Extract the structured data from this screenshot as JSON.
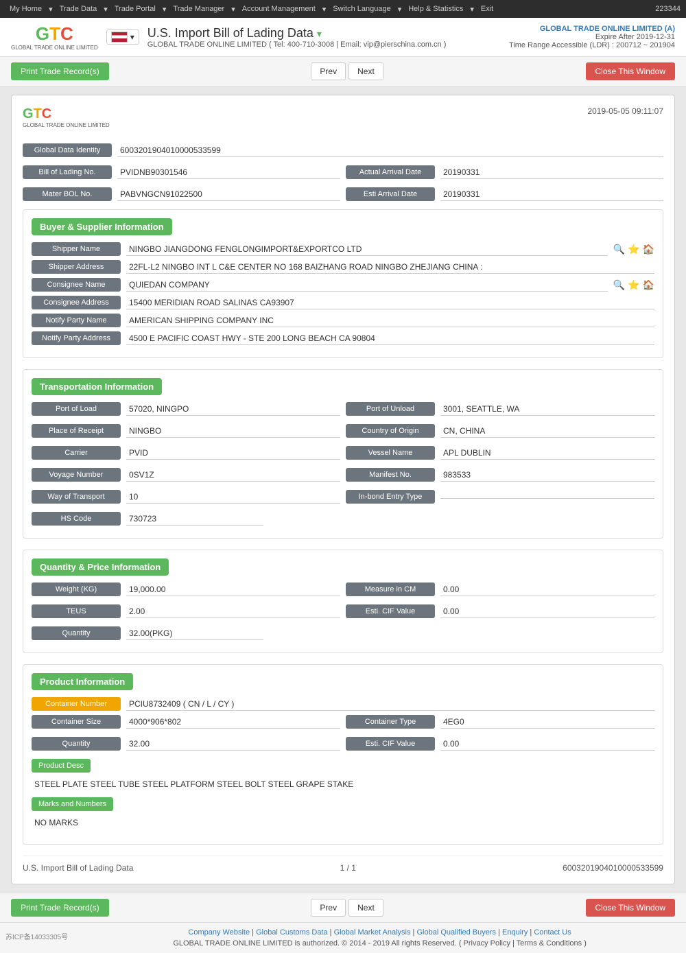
{
  "topnav": {
    "items": [
      "My Home",
      "Trade Data",
      "Trade Portal",
      "Trade Manager",
      "Account Management",
      "Switch Language",
      "Help & Statistics",
      "Exit"
    ],
    "account": "223344"
  },
  "header": {
    "title": "U.S. Import Bill of Lading Data",
    "subtitle": "GLOBAL TRADE ONLINE LIMITED ( Tel: 400-710-3008 | Email: vip@pierschina.com.cn )",
    "company": "GLOBAL TRADE ONLINE LIMITED (A)",
    "expire": "Expire After 2019-12-31",
    "ldr": "Time Range Accessible (LDR) : 200712 ~ 201904"
  },
  "toolbar": {
    "print_label": "Print Trade Record(s)",
    "prev_label": "Prev",
    "next_label": "Next",
    "close_label": "Close This Window"
  },
  "card": {
    "timestamp": "2019-05-05 09:11:07",
    "logo_top": "GTC",
    "logo_subtitle": "GLOBAL TRADE ONLINE LIMITED",
    "global_data_identity_label": "Global Data Identity",
    "global_data_identity_value": "6003201904010000533599",
    "bol_no_label": "Bill of Lading No.",
    "bol_no_value": "PVIDNB90301546",
    "actual_arrival_label": "Actual Arrival Date",
    "actual_arrival_value": "20190331",
    "master_bol_label": "Mater BOL No.",
    "master_bol_value": "PABVNGCN91022500",
    "esti_arrival_label": "Esti Arrival Date",
    "esti_arrival_value": "20190331"
  },
  "buyer_supplier": {
    "section_title": "Buyer & Supplier Information",
    "shipper_name_label": "Shipper Name",
    "shipper_name_value": "NINGBO JIANGDONG FENGLONGIMPORT&EXPORTCO LTD",
    "shipper_address_label": "Shipper Address",
    "shipper_address_value": "22FL-L2 NINGBO INT L C&E CENTER NO 168 BAIZHANG ROAD NINGBO ZHEJIANG CHINA :",
    "consignee_name_label": "Consignee Name",
    "consignee_name_value": "QUIEDAN COMPANY",
    "consignee_address_label": "Consignee Address",
    "consignee_address_value": "15400 MERIDIAN ROAD SALINAS CA93907",
    "notify_party_label": "Notify Party Name",
    "notify_party_value": "AMERICAN SHIPPING COMPANY INC",
    "notify_address_label": "Notify Party Address",
    "notify_address_value": "4500 E PACIFIC COAST HWY - STE 200 LONG BEACH CA 90804"
  },
  "transportation": {
    "section_title": "Transportation Information",
    "port_load_label": "Port of Load",
    "port_load_value": "57020, NINGPO",
    "port_unload_label": "Port of Unload",
    "port_unload_value": "3001, SEATTLE, WA",
    "place_receipt_label": "Place of Receipt",
    "place_receipt_value": "NINGBO",
    "country_origin_label": "Country of Origin",
    "country_origin_value": "CN, CHINA",
    "carrier_label": "Carrier",
    "carrier_value": "PVID",
    "vessel_name_label": "Vessel Name",
    "vessel_name_value": "APL DUBLIN",
    "voyage_number_label": "Voyage Number",
    "voyage_number_value": "0SV1Z",
    "manifest_label": "Manifest No.",
    "manifest_value": "983533",
    "way_transport_label": "Way of Transport",
    "way_transport_value": "10",
    "inbond_label": "In-bond Entry Type",
    "inbond_value": "",
    "hs_code_label": "HS Code",
    "hs_code_value": "730723"
  },
  "quantity_price": {
    "section_title": "Quantity & Price Information",
    "weight_label": "Weight (KG)",
    "weight_value": "19,000.00",
    "measure_label": "Measure in CM",
    "measure_value": "0.00",
    "teus_label": "TEUS",
    "teus_value": "2.00",
    "esti_cif_label": "Esti. CIF Value",
    "esti_cif_value": "0.00",
    "quantity_label": "Quantity",
    "quantity_value": "32.00(PKG)"
  },
  "product_info": {
    "section_title": "Product Information",
    "container_number_label": "Container Number",
    "container_number_value": "PCIU8732409 ( CN / L / CY )",
    "container_size_label": "Container Size",
    "container_size_value": "4000*906*802",
    "container_type_label": "Container Type",
    "container_type_value": "4EG0",
    "quantity_label": "Quantity",
    "quantity_value": "32.00",
    "esti_cif_label": "Esti. CIF Value",
    "esti_cif_value": "0.00",
    "product_desc_label": "Product Desc",
    "product_desc_value": "STEEL PLATE STEEL TUBE STEEL PLATFORM STEEL BOLT STEEL GRAPE STAKE",
    "marks_label": "Marks and Numbers",
    "marks_value": "NO MARKS"
  },
  "card_footer": {
    "left": "U.S. Import Bill of Lading Data",
    "center": "1 / 1",
    "right": "6003201904010000533599"
  },
  "footer": {
    "icp": "苏ICP备14033305号",
    "links": [
      "Company Website",
      "Global Customs Data",
      "Global Market Analysis",
      "Global Qualified Buyers",
      "Enquiry",
      "Contact Us"
    ],
    "copyright": "GLOBAL TRADE ONLINE LIMITED is authorized. © 2014 - 2019 All rights Reserved.  ( Privacy Policy | Terms & Conditions )"
  }
}
